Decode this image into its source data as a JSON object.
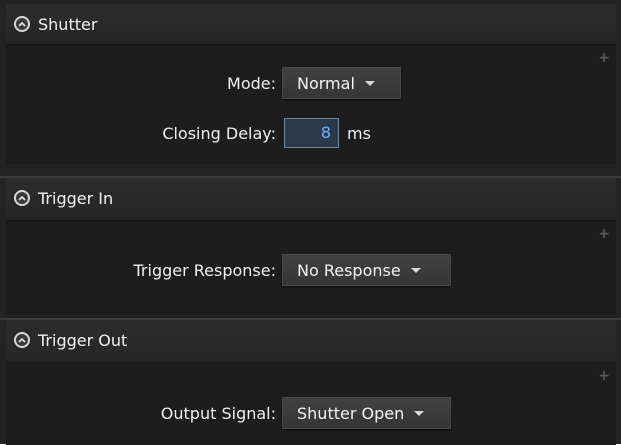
{
  "shutter": {
    "title": "Shutter",
    "mode_label": "Mode:",
    "mode_value": "Normal",
    "closing_delay_label": "Closing Delay:",
    "closing_delay_value": "8",
    "closing_delay_unit": "ms"
  },
  "trigger_in": {
    "title": "Trigger In",
    "response_label": "Trigger Response:",
    "response_value": "No Response"
  },
  "trigger_out": {
    "title": "Trigger Out",
    "output_label": "Output Signal:",
    "output_value": "Shutter Open"
  },
  "icons": {
    "collapse": "chevron-up-circle-icon",
    "add": "plus-icon"
  },
  "colors": {
    "background": "#232323",
    "section_body": "#1d1d1d",
    "input_text": "#6fb3ff"
  }
}
